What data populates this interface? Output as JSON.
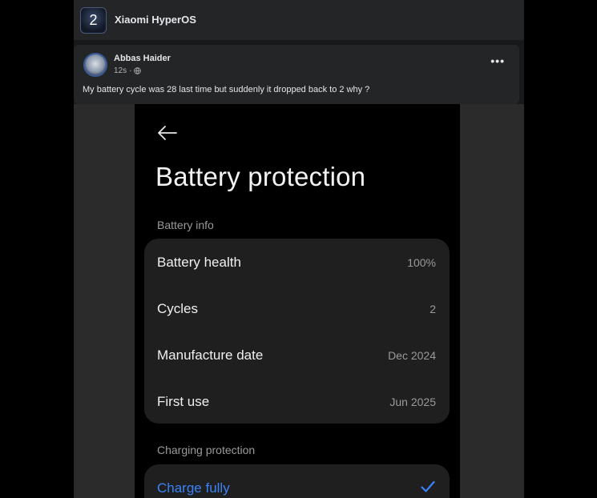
{
  "group": {
    "avatar_text": "2",
    "name": "Xiaomi HyperOS"
  },
  "post": {
    "author": "Abbas Haider",
    "time": "12s",
    "separator": "·",
    "text": "My battery cycle was 28 last time but suddenly it dropped back to 2 why ?",
    "more_label": "•••"
  },
  "screen": {
    "title": "Battery protection",
    "battery_info_label": "Battery info",
    "rows": [
      {
        "label": "Battery health",
        "value": "100%"
      },
      {
        "label": "Cycles",
        "value": "2"
      },
      {
        "label": "Manufacture date",
        "value": "Dec 2024"
      },
      {
        "label": "First use",
        "value": "Jun 2025"
      }
    ],
    "charging_protection_label": "Charging protection",
    "charge_option": "Charge fully"
  },
  "icons": {
    "back": "arrow-left-icon",
    "check": "check-icon",
    "globe": "globe-icon",
    "more": "more-icon"
  },
  "colors": {
    "accent": "#3b82f6",
    "fb_surface": "#242526",
    "screen_bg": "#000000",
    "card_bg": "#1f1f1f"
  }
}
